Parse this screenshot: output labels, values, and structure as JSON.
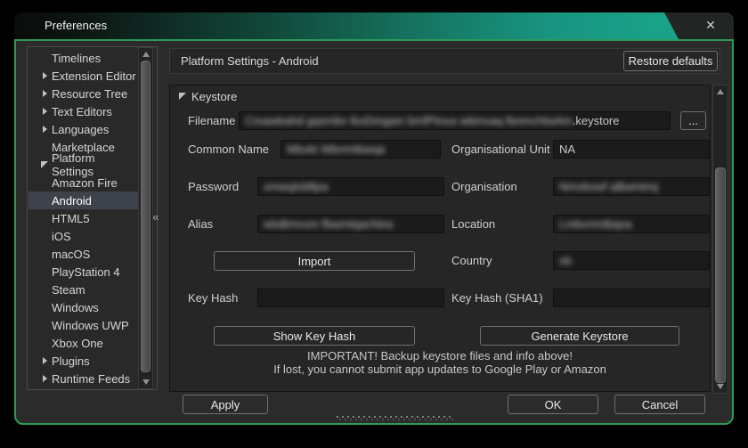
{
  "window": {
    "title": "Preferences",
    "close_icon": "✕",
    "collapse_handle": "«"
  },
  "sidebar": {
    "items": [
      {
        "label": "Timelines"
      },
      {
        "label": "Extension Editor",
        "state": "collapsed"
      },
      {
        "label": "Resource Tree",
        "state": "collapsed"
      },
      {
        "label": "Text Editors",
        "state": "collapsed"
      },
      {
        "label": "Languages",
        "state": "collapsed"
      },
      {
        "label": "Marketplace"
      },
      {
        "label": "Platform Settings",
        "state": "expanded"
      },
      {
        "label": "Amazon Fire",
        "child": true
      },
      {
        "label": "Android",
        "child": true,
        "selected": true
      },
      {
        "label": "HTML5",
        "child": true
      },
      {
        "label": "iOS",
        "child": true
      },
      {
        "label": "macOS",
        "child": true
      },
      {
        "label": "PlayStation 4",
        "child": true
      },
      {
        "label": "Steam",
        "child": true
      },
      {
        "label": "Windows",
        "child": true
      },
      {
        "label": "Windows UWP",
        "child": true
      },
      {
        "label": "Xbox One",
        "child": true
      },
      {
        "label": "Plugins",
        "state": "collapsed"
      },
      {
        "label": "Runtime Feeds",
        "state": "collapsed"
      }
    ]
  },
  "header": {
    "title": "Platform Settings - Android",
    "restore_defaults_label": "Restore defaults"
  },
  "keystore": {
    "section_label": "Keystore",
    "filename": {
      "label": "Filename",
      "redacted_mask": "Cmawbahd gqsmbv lkoDmgwn bmfPtnxa wbmvaq lbnmchtwAm",
      "suffix": ".keystore",
      "browse_label": "..."
    },
    "common_name": {
      "label": "Common Name",
      "redacted_mask": "Mbvkt Wbnmtbwqa"
    },
    "organisational_unit": {
      "label": "Organisational Unit",
      "value": "NA"
    },
    "password": {
      "label": "Password",
      "redacted_mask": "xmwqlvbftpa"
    },
    "organisation": {
      "label": "Organisation",
      "redacted_mask": "Nmvbxwf aBwmtnq"
    },
    "alias": {
      "label": "Alias",
      "redacted_mask": "wlxBmvxm fbwmtqachtns"
    },
    "location": {
      "label": "Location",
      "redacted_mask": "Lmbvnmtbqsa"
    },
    "import_label": "Import",
    "country": {
      "label": "Country",
      "redacted_mask": "xb"
    },
    "key_hash": {
      "label": "Key Hash",
      "value": ""
    },
    "key_hash_sha1": {
      "label": "Key Hash (SHA1)",
      "value": ""
    },
    "show_key_hash_label": "Show Key Hash",
    "generate_keystore_label": "Generate Keystore",
    "warning_line1": "IMPORTANT! Backup keystore files and info above!",
    "warning_line2": "If lost, you cannot submit app updates to Google Play or Amazon"
  },
  "footer": {
    "apply_label": "Apply",
    "ok_label": "OK",
    "cancel_label": "Cancel"
  },
  "colors": {
    "accent_green_border": "#2c9c55",
    "titlebar_teal": "#1aa289",
    "selection_background": "#3e434b",
    "panel_background": "#262626",
    "input_background": "#1b1b1b"
  }
}
